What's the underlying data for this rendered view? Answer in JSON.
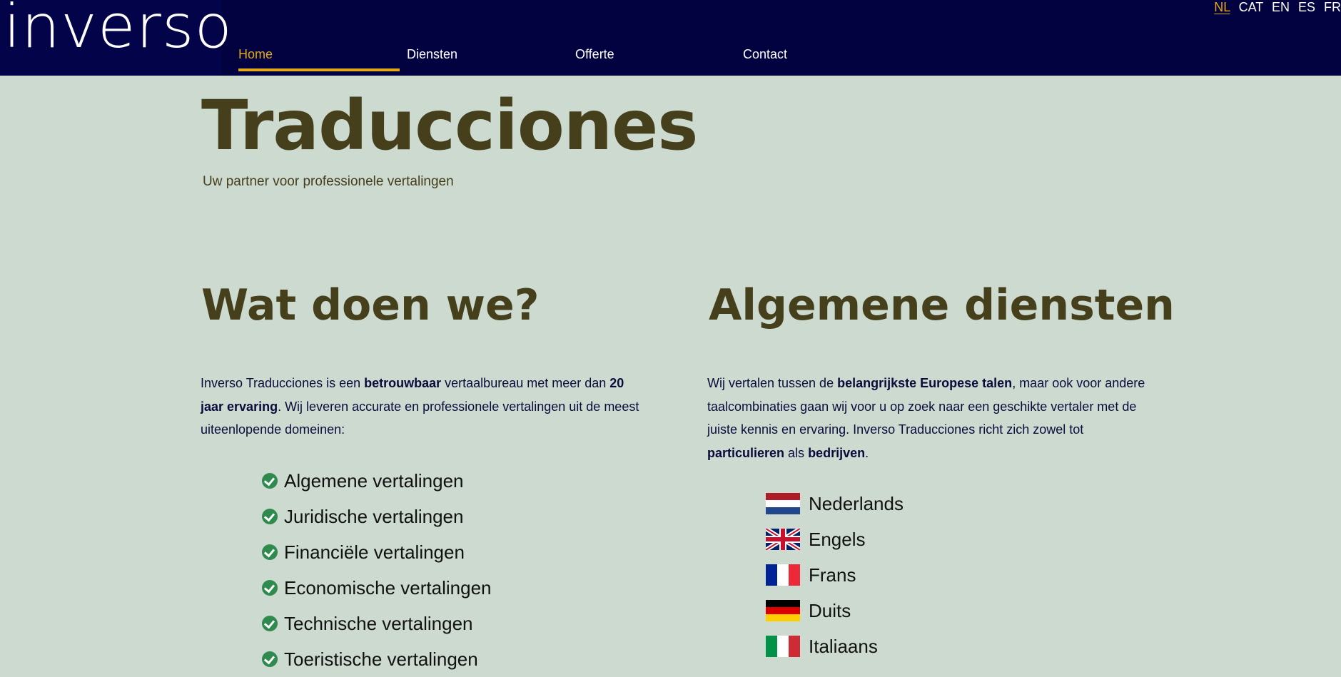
{
  "header": {
    "logo_text": "inverso",
    "nav": [
      {
        "label": "Home",
        "active": true
      },
      {
        "label": "Diensten",
        "active": false
      },
      {
        "label": "Offerte",
        "active": false
      },
      {
        "label": "Contact",
        "active": false
      }
    ],
    "languages": [
      {
        "label": "NL",
        "active": true
      },
      {
        "label": "CAT",
        "active": false
      },
      {
        "label": "EN",
        "active": false
      },
      {
        "label": "ES",
        "active": false
      },
      {
        "label": "FR",
        "active": false
      }
    ]
  },
  "hero": {
    "title": "Traducciones",
    "subtitle": "Uw partner voor professionele vertalingen"
  },
  "left": {
    "heading": "Wat doen we?",
    "intro_1": "Inverso Traducciones is een ",
    "intro_b1": "betrouwbaar",
    "intro_2": " vertaalbureau met meer dan ",
    "intro_b2": "20 jaar ervaring",
    "intro_3": ". Wij leveren accurate en professionele vertalingen uit de meest uiteenlopende domeinen:",
    "services": [
      "Algemene vertalingen",
      "Juridische vertalingen",
      "Financiële vertalingen",
      "Economische vertalingen",
      "Technische vertalingen",
      "Toeristische vertalingen"
    ]
  },
  "right": {
    "heading": "Algemene diensten",
    "intro_1": "Wij vertalen tussen de ",
    "intro_b1": "belangrijkste Europese talen",
    "intro_2": ", maar ook voor andere taalcombinaties gaan wij voor u op zoek naar een geschikte vertaler met de juiste kennis en ervaring. Inverso Traducciones richt zich zowel tot ",
    "intro_b2": "particulieren",
    "intro_3": " als ",
    "intro_b3": "bedrijven",
    "intro_4": ".",
    "languages": [
      {
        "label": "Nederlands",
        "icon": "netherlands-flag-icon"
      },
      {
        "label": "Engels",
        "icon": "uk-flag-icon"
      },
      {
        "label": "Frans",
        "icon": "france-flag-icon"
      },
      {
        "label": "Duits",
        "icon": "germany-flag-icon"
      },
      {
        "label": "Italiaans",
        "icon": "italy-flag-icon"
      }
    ]
  },
  "colors": {
    "header_bg": "#020240",
    "page_bg": "#ccdad0",
    "accent": "#e3a81c",
    "heading": "#463f1c",
    "text": "#0b0b3b",
    "check": "#2f8a4e"
  }
}
